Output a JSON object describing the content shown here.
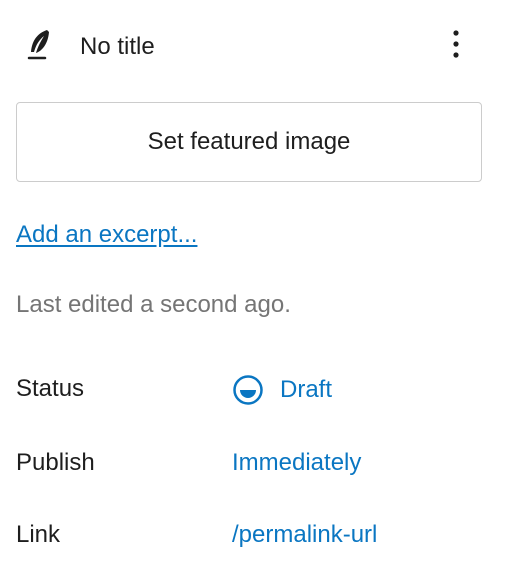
{
  "header": {
    "title": "No title",
    "icon": "feather-pen-icon",
    "more_icon": "vertical-ellipsis-icon"
  },
  "featured_image": {
    "label": "Set featured image"
  },
  "excerpt": {
    "label": "Add an excerpt..."
  },
  "meta": {
    "last_edited": "Last edited a second ago."
  },
  "rows": [
    {
      "label": "Status",
      "value": "Draft",
      "icon": "draft-status-icon"
    },
    {
      "label": "Publish",
      "value": "Immediately"
    },
    {
      "label": "Link",
      "value": "/permalink-url"
    }
  ],
  "colors": {
    "accent": "#0a76c2",
    "muted": "#757575",
    "text": "#1e1e1e",
    "border": "#cccccc"
  }
}
